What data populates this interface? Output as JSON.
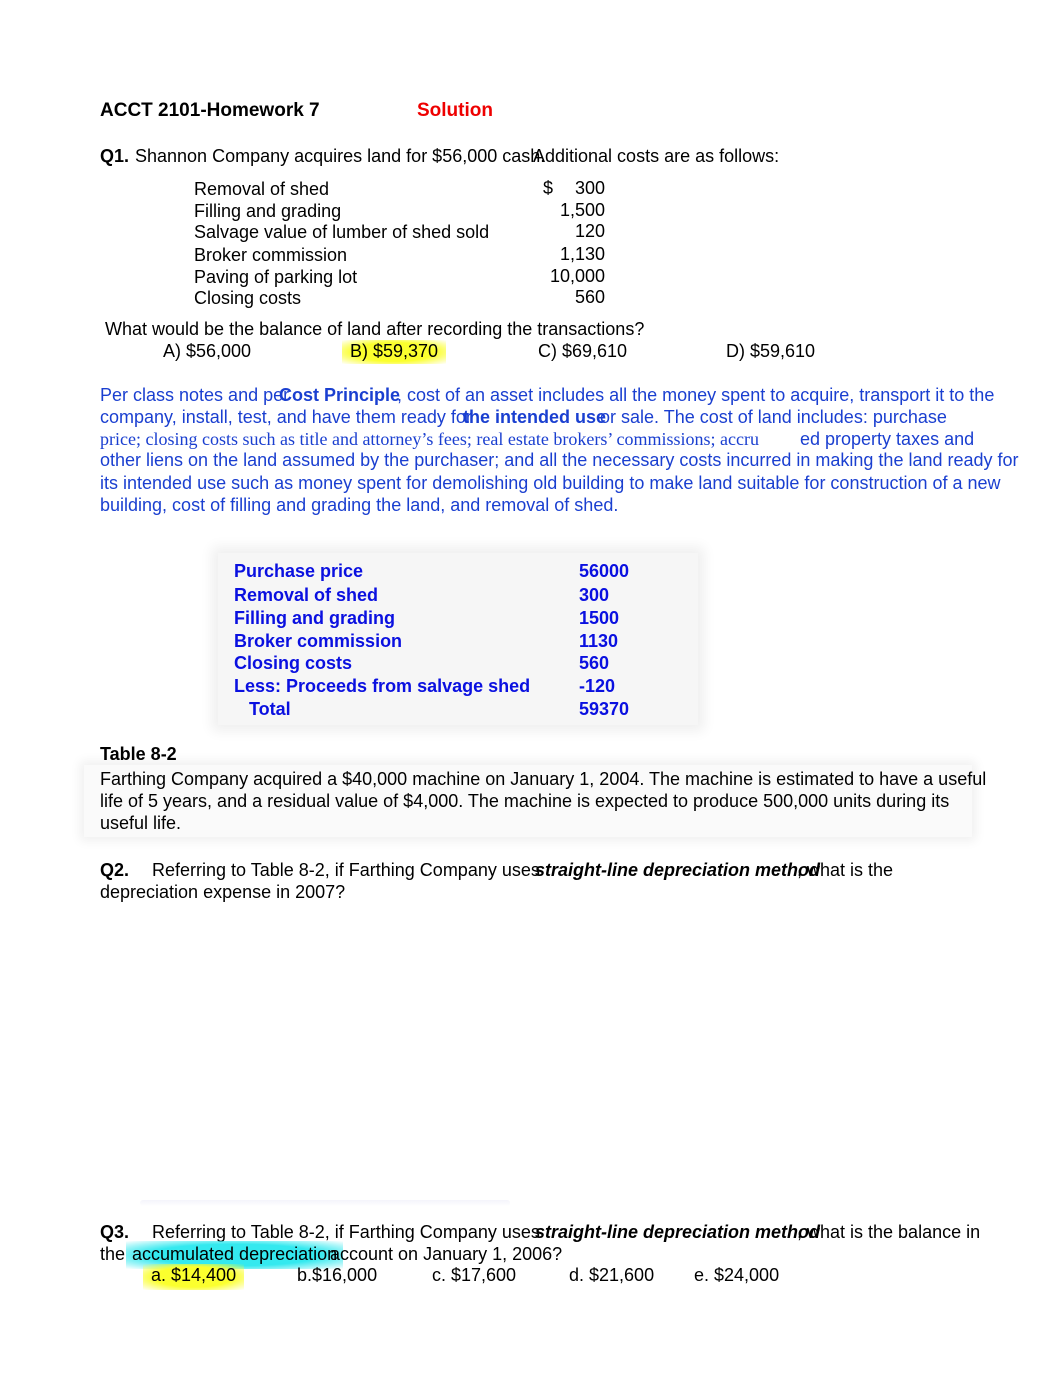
{
  "header": {
    "title": "ACCT 2101-Homework 7",
    "solution_label": "Solution"
  },
  "q1": {
    "number": "Q1.",
    "text_part1": "Shannon Company acquires land for $56,000 cash.",
    "text_part2": "Additional costs are as follows:",
    "costs": [
      {
        "label": "Removal of shed",
        "currency": "$",
        "value": "300"
      },
      {
        "label": "Filling and grading",
        "currency": "",
        "value": "1,500"
      },
      {
        "label": "Salvage value of lumber of shed sold",
        "currency": "",
        "value": "120"
      },
      {
        "label": "Broker commission",
        "currency": "",
        "value": "1,130"
      },
      {
        "label": "Paving of parking lot",
        "currency": "",
        "value": "10,000"
      },
      {
        "label": "Closing costs",
        "currency": "",
        "value": "560"
      }
    ],
    "question": "What would be the balance of land after recording the transactions?",
    "choices": [
      {
        "label": "A) $56,000",
        "highlighted": false
      },
      {
        "label": "B) $59,370",
        "highlighted": true
      },
      {
        "label": "C) $69,610",
        "highlighted": false
      },
      {
        "label": "D) $59,610",
        "highlighted": false
      }
    ]
  },
  "explanation": {
    "line1_a": "Per class notes and per",
    "line1_bold": "Cost Principle",
    "line1_b": ", cost of an asset includes all the money spent to acquire, transport it to the",
    "line2_a": "company, install, test, and have them ready for",
    "line2_bold": "the intended use",
    "line2_b": "or sale.  The cost of land includes: purchase",
    "line3_serif": "price; closing costs such as title and attorney’s fees; real estate brokers’ commissions; accru",
    "line3_b": "ed property taxes and",
    "line4": "other liens on the land assumed by the purchaser; and all the necessary costs incurred in making the land ready for",
    "line5": "its intended use such as money spent for demolishing old building to make land suitable for construction of a new",
    "line6": "building, cost of filling and grading the land, and removal of shed."
  },
  "calculation": {
    "rows": [
      {
        "label": "Purchase price",
        "value": "56000"
      },
      {
        "label": "Removal of shed",
        "value": "300"
      },
      {
        "label": "Filling and grading",
        "value": "1500"
      },
      {
        "label": "Broker commission",
        "value": "1130"
      },
      {
        "label": "Closing costs",
        "value": "560"
      },
      {
        "label": "Less: Proceeds from salvage shed",
        "value": "-120"
      },
      {
        "label": "   Total",
        "value": "59370"
      }
    ]
  },
  "table82": {
    "title": "Table 8-2",
    "line1": "Farthing Company acquired a $40,000 machine on January 1, 2004. The machine is estimated to have a useful",
    "line2": "life of 5 years, and a residual value of $4,000. The machine is expected to produce 500,000 units during its",
    "line3": "useful life."
  },
  "q2": {
    "number": "Q2.",
    "text_a": "Referring to Table 8-2, if Farthing Company uses",
    "text_bold": "straight-line depreciation method",
    "text_b": ", what is the",
    "line2": "depreciation expense in 2007?"
  },
  "q3": {
    "number": "Q3.",
    "text_a": "Referring to Table 8-2, if Farthing Company uses",
    "text_bold": "straight-line depreciation method",
    "text_b": ", what is the balance in",
    "line2_a": "the",
    "line2_hl": "accumulated depreciation",
    "line2_b": "account on January 1, 2006?",
    "choices": [
      {
        "label": "a. $14,400",
        "highlighted": true
      },
      {
        "label": "b.$16,000",
        "highlighted": false
      },
      {
        "label": "c. $17,600",
        "highlighted": false
      },
      {
        "label": "d. $21,600",
        "highlighted": false
      },
      {
        "label": "e. $24,000",
        "highlighted": false
      }
    ]
  },
  "colors": {
    "solution": "#ee0000",
    "explanation_text": "#1a3fd0",
    "calc_text": "#0a10e0",
    "highlight_yellow": "#fbff2e",
    "highlight_cyan": "#34e9ef"
  }
}
